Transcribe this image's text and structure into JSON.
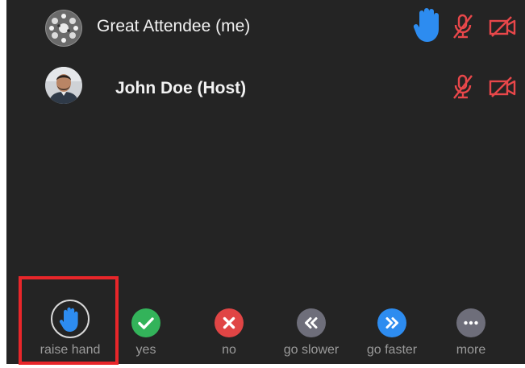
{
  "participants": [
    {
      "name": "Great Attendee (me)",
      "avatar_icon": "pattern-avatar",
      "hand_raised": true,
      "mic_status": "muted",
      "video_status": "off"
    },
    {
      "name": "John Doe (Host)",
      "avatar_icon": "photo-avatar",
      "hand_raised": false,
      "mic_status": "muted",
      "video_status": "off"
    }
  ],
  "feedback": {
    "buttons": [
      {
        "label": "raise hand",
        "icon": "hand-icon",
        "color": "#2d8cf0"
      },
      {
        "label": "yes",
        "icon": "check-icon",
        "color": "#33b35a"
      },
      {
        "label": "no",
        "icon": "x-icon",
        "color": "#e04545"
      },
      {
        "label": "go slower",
        "icon": "double-chevron-left-icon",
        "color": "#6e6e7a"
      },
      {
        "label": "go faster",
        "icon": "double-chevron-right-icon",
        "color": "#2d8cf0"
      },
      {
        "label": "more",
        "icon": "more-dots-icon",
        "color": "#6e6e7a"
      }
    ],
    "highlighted": "raise hand"
  },
  "colors": {
    "panel_bg": "#242424",
    "muted_red": "#e8474a",
    "hand_blue": "#2d8cf0",
    "highlight_red": "#e8262a"
  }
}
